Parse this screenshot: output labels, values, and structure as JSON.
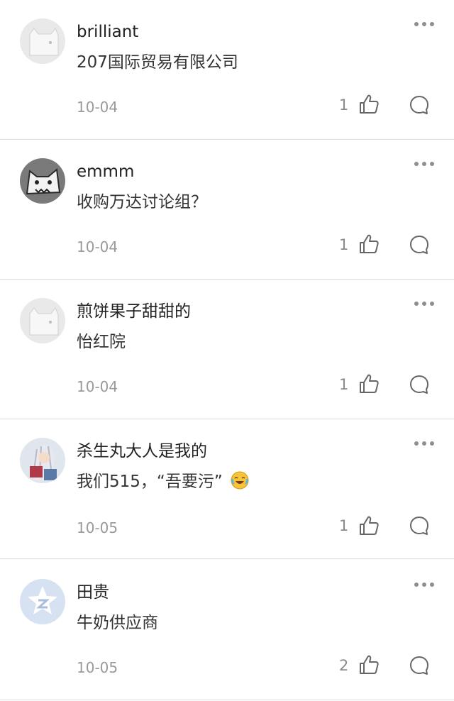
{
  "comments": [
    {
      "username": "brilliant",
      "text": "207国际贸易有限公司",
      "date": "10-04",
      "likes": "1",
      "avatar": "white-dog-avatar"
    },
    {
      "username": "emmm",
      "text": "收购万达讨论组？",
      "date": "10-04",
      "likes": "1",
      "avatar": "gray-wolf-avatar"
    },
    {
      "username": "煎饼果子甜甜的",
      "text": "怡红院",
      "date": "10-04",
      "likes": "1",
      "avatar": "white-dog-avatar"
    },
    {
      "username": "杀生丸大人是我的",
      "text": "我们515，“吾要污”",
      "emoji": "crying-laughing-emoji",
      "date": "10-05",
      "likes": "1",
      "avatar": "anime-character-avatar"
    },
    {
      "username": "田贵",
      "text": "牛奶供应商",
      "date": "10-05",
      "likes": "2",
      "avatar": "qq-logo-avatar"
    }
  ],
  "icons": {
    "more": "more-dots-icon",
    "like": "thumbs-up-icon",
    "reply": "comment-bubble-icon"
  },
  "colors": {
    "text_primary": "#222222",
    "text_secondary": "#9a9a9a",
    "divider": "#dcdcdc",
    "icon": "#8a8a8a"
  }
}
